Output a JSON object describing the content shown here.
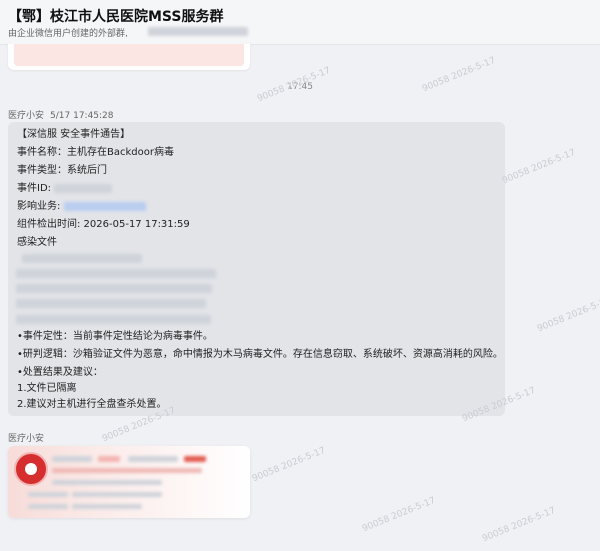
{
  "header": {
    "title": "【鄂】枝江市人民医院MSS服务群",
    "subtitle": "由企业微信用户创建的外部群,"
  },
  "time_separator": "17:45",
  "messages": [
    {
      "sender": "医疗小安",
      "time": "5/17 17:45:28",
      "lines": {
        "l0": "【深信服 安全事件通告】",
        "l1": "事件名称：主机存在Backdoor病毒",
        "l2": "事件类型：系统后门",
        "l3": "事件ID:",
        "l4": "影响业务:",
        "l5": "组件检出时间:  2026-05-17 17:31:59",
        "l6": "感染文件",
        "l7": "•事件定性：当前事件定性结论为病毒事件。",
        "l8": "•研判逻辑：沙箱验证文件为恶意，命中情报为木马病毒文件。存在信息窃取、系统破坏、资源高消耗的风险。",
        "l9": "•处置结果及建议：",
        "l10": "1.文件已隔离",
        "l11": "2.建议对主机进行全盘查杀处置。"
      }
    },
    {
      "sender": "医疗小安"
    }
  ],
  "watermark": "90058 2026-5-17"
}
